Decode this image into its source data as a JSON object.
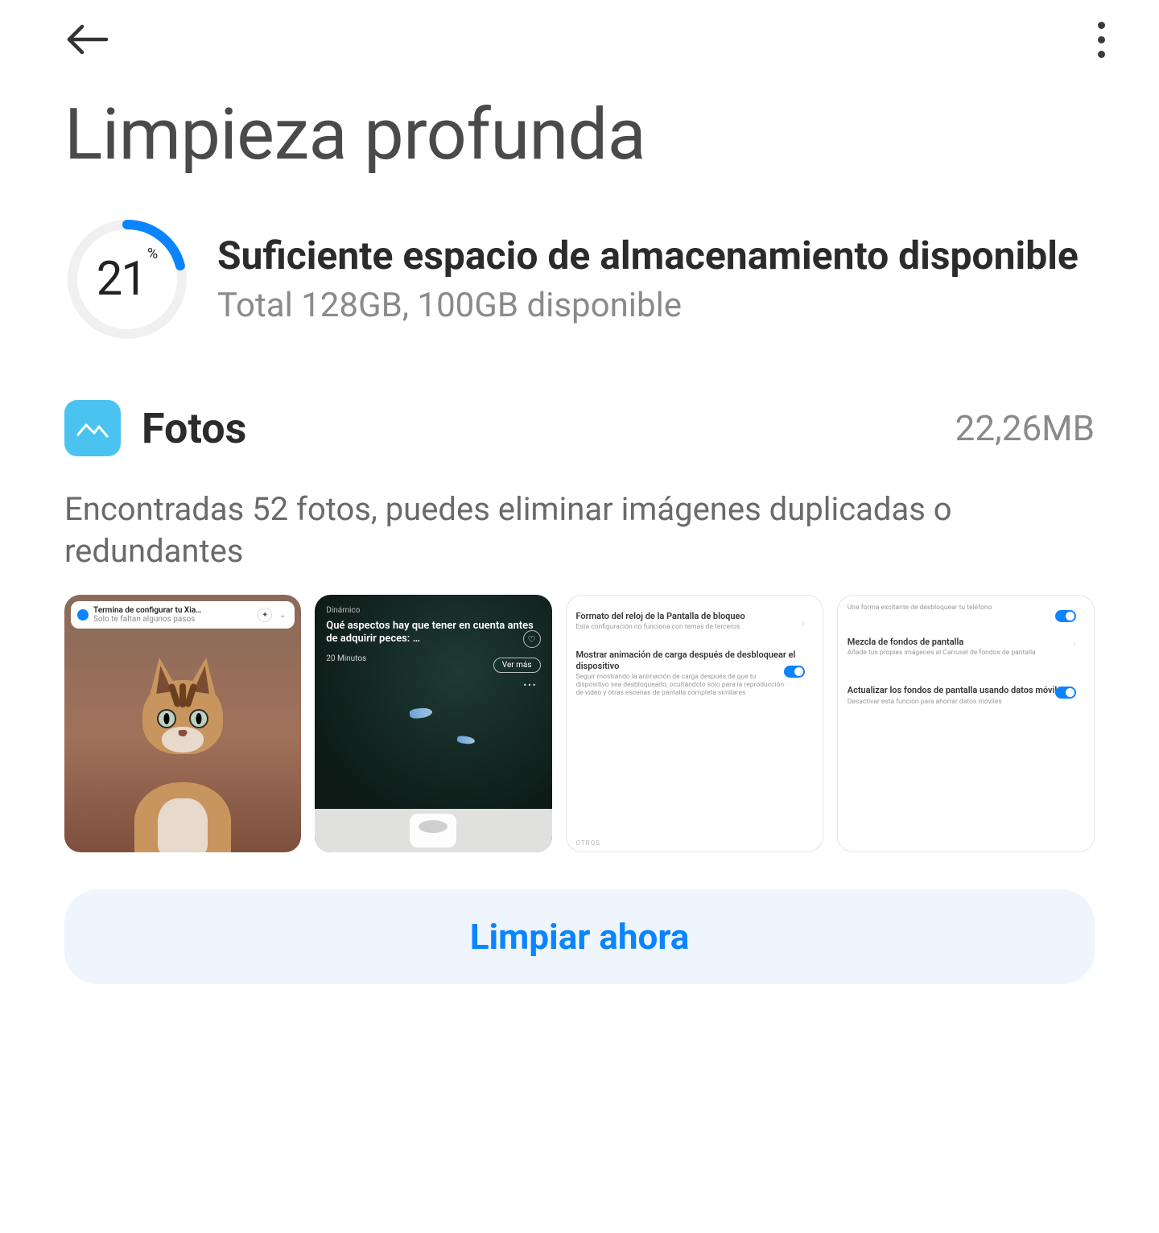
{
  "header": {
    "title": "Limpieza profunda"
  },
  "storage": {
    "percent": 21,
    "unit": "%",
    "heading": "Suficiente espacio de almacenamiento disponible",
    "sub": "Total 128GB, 100GB disponible"
  },
  "section": {
    "title": "Fotos",
    "size": "22,26MB",
    "description": "Encontradas 52 fotos, puedes eliminar imágenes duplicadas o redundantes"
  },
  "thumbnails": {
    "t1": {
      "notif_title": "Termina de configurar tu Xia…",
      "notif_sub": "Solo te faltan algunos pasos"
    },
    "t2": {
      "tag": "Dinámico",
      "headline": "Qué aspectos hay que tener en cuenta antes de adquirir peces: …",
      "source": "20 Minutos",
      "vermas": "Ver más"
    },
    "t3": {
      "i1_title": "Formato del reloj de la Pantalla de bloqueo",
      "i1_sub": "Esta configuración no funciona con temas de terceros",
      "i2_title": "Mostrar animación de carga después de desbloquear el dispositivo",
      "i2_sub": "Seguir mostrando la animación de carga después de que tu dispositivo sea desbloqueado, ocultándolo solo para la reproducción de video y otras escenas de pantalla completa similares",
      "otros": "OTROS"
    },
    "t4": {
      "topline": "Una forma excitante de desbloquear tu teléfono",
      "i1_title": "Mezcla de fondos de pantalla",
      "i1_sub": "Añade tus propias imágenes al Carrusel de fondos de pantalla",
      "i2_title": "Actualizar los fondos de pantalla usando datos móviles",
      "i2_sub": "Desactivar esta función para ahorrar datos móviles"
    }
  },
  "action": {
    "clean_now": "Limpiar ahora"
  }
}
